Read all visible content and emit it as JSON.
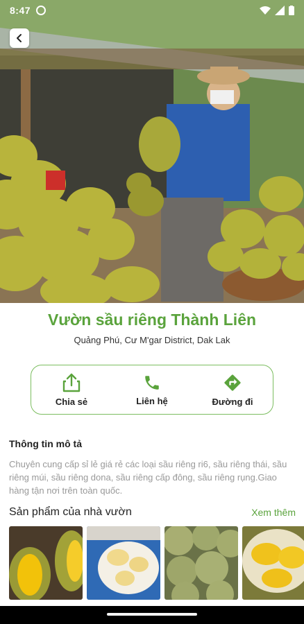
{
  "status_bar": {
    "time": "8:47",
    "icons": [
      "camera-circle-icon",
      "wifi-icon",
      "signal-icon",
      "battery-icon"
    ]
  },
  "nav": {
    "back_icon": "chevron-left-icon"
  },
  "garden": {
    "name": "Vườn sầu riêng Thành Liên",
    "address": "Quảng Phú, Cư M'gar District, Dak Lak"
  },
  "actions": [
    {
      "label": "Chia sẻ",
      "icon": "share-icon"
    },
    {
      "label": "Liên hệ",
      "icon": "phone-icon"
    },
    {
      "label": "Đường đi",
      "icon": "directions-icon"
    }
  ],
  "description": {
    "title": "Thông tin mô tả",
    "text": "Chuyên cung cấp sỉ lẻ giá rẻ các loại sầu riêng ri6, sầu riêng thái, sầu riêng múi, sầu riêng dona, sầu riêng cấp đông, sầu riêng rụng.Giao hàng tận nơi trên toàn quốc."
  },
  "products": {
    "title": "Sản phẩm của nhà vườn",
    "see_more": "Xem thêm"
  },
  "colors": {
    "accent": "#5aa33c",
    "border": "#7bbd5f",
    "muted_text": "#999999"
  }
}
